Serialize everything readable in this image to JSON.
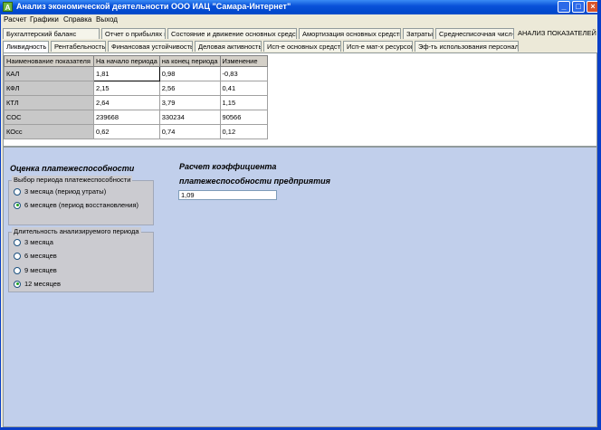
{
  "window": {
    "title": "Анализ экономической деятельности ООО ИАЦ \"Самара-Интернет\"",
    "app_icon_letter": "A",
    "minimize_glyph": "_",
    "maximize_glyph": "□",
    "close_glyph": "×"
  },
  "menu": [
    "Расчет",
    "Графики",
    "Справка",
    "Выход"
  ],
  "main_tabs": [
    "Бухгалтерский баланс",
    "Отчет о прибылях и убытках",
    "Состояние и движение основных средств",
    "Амортизация основных средств",
    "Затраты",
    "Среднесписочная числ-ть",
    "АНАЛИЗ ПОКАЗАТЕЛЕЙ"
  ],
  "sub_tabs": [
    "Ликвидность",
    "Рентабельность",
    "Финансовая устойчивость",
    "Деловая активность",
    "Исп-е основных средств",
    "Исп-е мат-х ресурсов",
    "Эф-ть использования персонала"
  ],
  "table": {
    "headers": [
      "Наименование показателя",
      "На начало периода",
      "на конец периода",
      "Изменение"
    ],
    "rows": [
      [
        "КАЛ",
        "1,81",
        "0,98",
        "-0,83"
      ],
      [
        "КФЛ",
        "2,15",
        "2,56",
        "0,41"
      ],
      [
        "КТЛ",
        "2,64",
        "3,79",
        "1,15"
      ],
      [
        "СОС",
        "239668",
        "330234",
        "90566"
      ],
      [
        "КОсс",
        "0,62",
        "0,74",
        "0,12"
      ]
    ]
  },
  "solvency": {
    "heading": "Оценка платежеспособности",
    "restore_group": {
      "title": "Выбор периода платежеспособности",
      "options": [
        "3 месяца (период утраты)",
        "6 месяцев (период восстановления)"
      ],
      "selected": 1
    },
    "period_group": {
      "title": "Длительность анализируемого периода",
      "options": [
        "3 месяца",
        "6 месяцев",
        "9 месяцев",
        "12 месяцев"
      ],
      "selected": 3
    }
  },
  "coefficient": {
    "heading_line1": "Расчет коэффициента",
    "heading_line2": "платежеспособности предприятия",
    "value": "1,09"
  }
}
